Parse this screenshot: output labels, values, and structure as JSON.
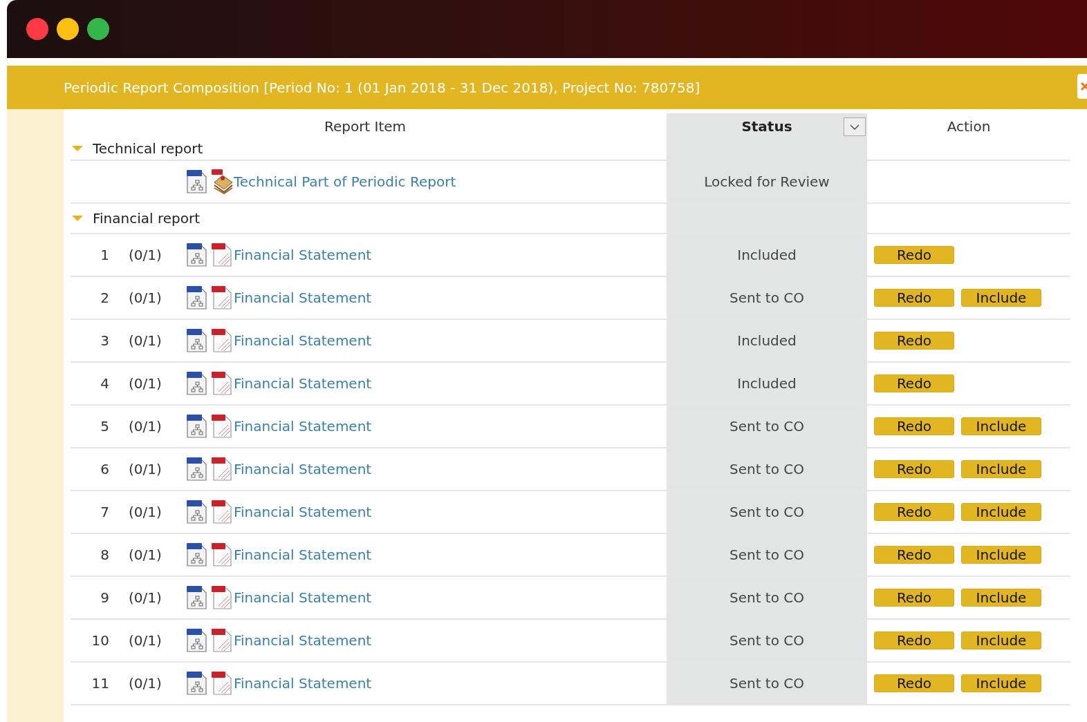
{
  "dialog": {
    "title": "Periodic Report Composition [Period No: 1 (01 Jan 2018 - 31 Dec 2018), Project No: 780758]"
  },
  "table": {
    "columns": [
      {
        "label": "Report Item",
        "filter": false
      },
      {
        "label": "Status",
        "filter": true
      },
      {
        "label": "Action",
        "filter": false
      }
    ],
    "groups": [
      {
        "label": "Technical report",
        "expanded": true,
        "items": [
          {
            "kind": "cover",
            "title": "Technical Part of Periodic Report",
            "status": "Locked for Review"
          }
        ]
      },
      {
        "label": "Financial report",
        "expanded": true,
        "items": [
          {
            "kind": "pdf",
            "number": "1",
            "fraction": "(0/1)",
            "title": "Financial Statement",
            "status": "Included",
            "actions": [
              "Redo"
            ]
          },
          {
            "kind": "pdf",
            "number": "2",
            "fraction": "(0/1)",
            "title": "Financial Statement",
            "status": "Sent to CO",
            "actions": [
              "Redo",
              "Include"
            ]
          },
          {
            "kind": "pdf",
            "number": "3",
            "fraction": "(0/1)",
            "title": "Financial Statement",
            "status": "Included",
            "actions": [
              "Redo"
            ]
          },
          {
            "kind": "pdf",
            "number": "4",
            "fraction": "(0/1)",
            "title": "Financial Statement",
            "status": "Included",
            "actions": [
              "Redo"
            ]
          },
          {
            "kind": "pdf",
            "number": "5",
            "fraction": "(0/1)",
            "title": "Financial Statement",
            "status": "Sent to CO",
            "actions": [
              "Redo",
              "Include"
            ]
          },
          {
            "kind": "pdf",
            "number": "6",
            "fraction": "(0/1)",
            "title": "Financial Statement",
            "status": "Sent to CO",
            "actions": [
              "Redo",
              "Include"
            ]
          },
          {
            "kind": "pdf",
            "number": "7",
            "fraction": "(0/1)",
            "title": "Financial Statement",
            "status": "Sent to CO",
            "actions": [
              "Redo",
              "Include"
            ]
          },
          {
            "kind": "pdf",
            "number": "8",
            "fraction": "(0/1)",
            "title": "Financial Statement",
            "status": "Sent to CO",
            "actions": [
              "Redo",
              "Include"
            ]
          },
          {
            "kind": "pdf",
            "number": "9",
            "fraction": "(0/1)",
            "title": "Financial Statement",
            "status": "Sent to CO",
            "actions": [
              "Redo",
              "Include"
            ]
          },
          {
            "kind": "pdf",
            "number": "10",
            "fraction": "(0/1)",
            "title": "Financial Statement",
            "status": "Sent to CO",
            "actions": [
              "Redo",
              "Include"
            ]
          },
          {
            "kind": "pdf",
            "number": "11",
            "fraction": "(0/1)",
            "title": "Financial Statement",
            "status": "Sent to CO",
            "actions": [
              "Redo",
              "Include"
            ]
          }
        ]
      }
    ]
  }
}
